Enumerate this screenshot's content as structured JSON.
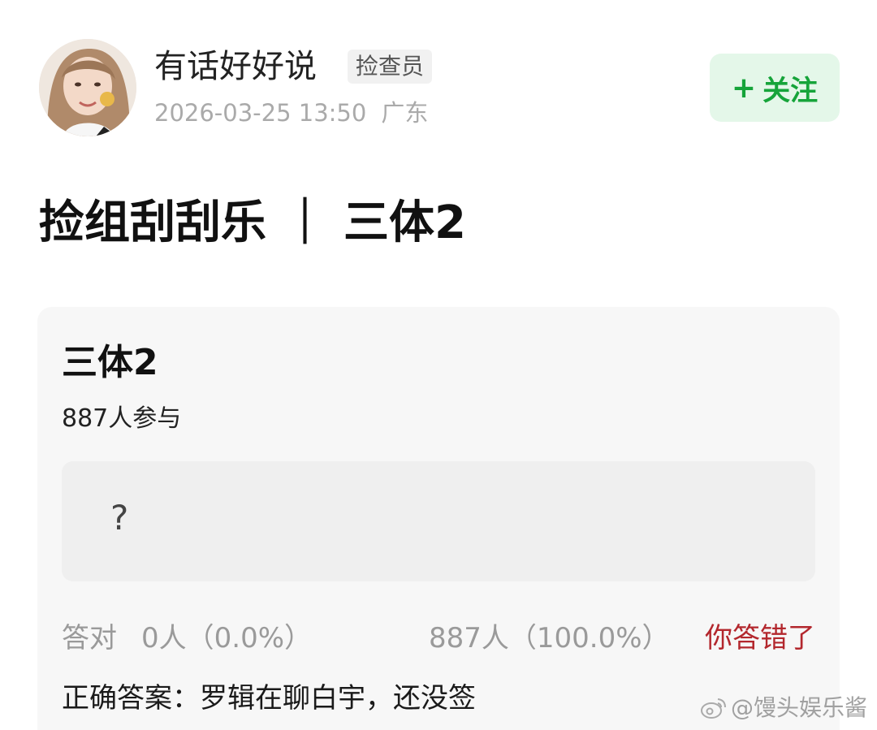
{
  "post": {
    "author_name": "有话好好说",
    "author_role": "捡查员",
    "timestamp": "2026-03-25 13:50",
    "location": "广东",
    "follow_label": "关注",
    "follow_prefix": "+",
    "title": "捡组刮刮乐 ｜ 三体2"
  },
  "quiz": {
    "title": "三体2",
    "participants": "887人参与",
    "answer_placeholder": "?",
    "correct_label": "答对",
    "correct_count": "0人（0.0%）",
    "wrong_count": "887人（100.0%）",
    "result": "你答错了",
    "correct_answer": "正确答案：罗辑在聊白宇，还没签"
  },
  "watermark": {
    "text": "@馒头娱乐酱"
  },
  "colors": {
    "accent_green": "#16a43a",
    "follow_bg": "#e4f7e9",
    "wrong_red": "#b3272d",
    "card_bg": "#f7f7f7"
  },
  "icons": {
    "avatar": "user-avatar-photo",
    "watermark": "weibo-logo-icon"
  }
}
